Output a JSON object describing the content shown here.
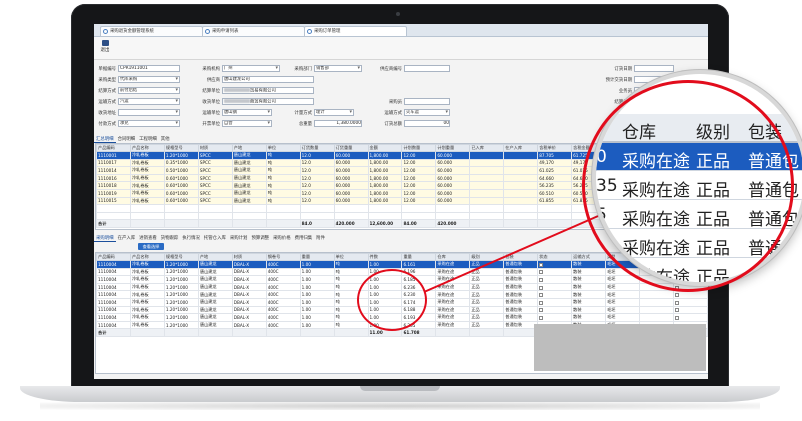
{
  "browser_tabs": [
    {
      "label": "采购退货金额管理系统"
    },
    {
      "label": "采购申请列表"
    },
    {
      "label": "采购订单管理"
    }
  ],
  "toolbar": {
    "save_label": "退出"
  },
  "form": {
    "fields": [
      {
        "label": "单据编号",
        "value": "CPR1911001"
      },
      {
        "label": "采购机构",
        "value": "广州"
      },
      {
        "label": "采购部门",
        "value": "销售部"
      },
      {
        "label": "供应商编号",
        "value": ""
      },
      {
        "label": "订货日期",
        "value": ""
      },
      {
        "label": "采购类型",
        "value": "代库采购"
      },
      {
        "label": "供应商",
        "value": "唐山建龙公司"
      },
      {
        "label": "预计交货日期",
        "value": ""
      },
      {
        "label": "结算方式",
        "value": "前付后结"
      },
      {
        "label": "结算单位",
        "value": "贸易有限公司"
      },
      {
        "label": "业务员",
        "value": ""
      },
      {
        "label": "运输方式",
        "value": "汽运"
      },
      {
        "label": "收货单位",
        "value": "商贸有限公司"
      },
      {
        "label": "采购员",
        "value": ""
      },
      {
        "label": "收货地址",
        "value": ""
      },
      {
        "label": "结算单位",
        "value": ""
      },
      {
        "label": "运输单位",
        "value": "唐山钢"
      },
      {
        "label": "计量方式",
        "value": "理计"
      },
      {
        "label": "运输方式",
        "value": "火车运"
      },
      {
        "label": "付款方式",
        "value": "承兑"
      },
      {
        "label": "开票单位",
        "value": "自营"
      },
      {
        "label": "总重量",
        "value": "1,380.0000"
      },
      {
        "label": "订货总额",
        "value": "00"
      }
    ]
  },
  "detail_tabs": [
    "汇总明细",
    "合同明细",
    "工程明细",
    "其他"
  ],
  "upper_grid": {
    "columns": [
      "产品编码",
      "产品名称",
      "规格型号",
      "材质",
      "产地",
      "单位",
      "订货数量",
      "订货重量",
      "金额",
      "计划数量",
      "计划重量",
      "已入库",
      "在产入库",
      "含税单价",
      "含税金额",
      "采购单价",
      "采购金额",
      "实际入库"
    ],
    "rows": [
      [
        "1110001",
        "冷轧卷板",
        "1.20*1000",
        "SPCC",
        "唐山建龙",
        "吨",
        "12.0",
        "60.000",
        "1,800.00",
        "12.00",
        "60.000",
        "",
        "",
        "87.705",
        "61.725",
        "30.025",
        "50.000",
        ""
      ],
      [
        "1110017",
        "冷轧卷板",
        "0.35*1000",
        "SPCC",
        "唐山建龙",
        "吨",
        "12.0",
        "60.000",
        "1,800.00",
        "12.00",
        "60.000",
        "",
        "",
        "49,170",
        "49,170",
        "",
        "",
        ""
      ],
      [
        "1110014",
        "冷轧卷板",
        "0.50*1000",
        "SPCC",
        "唐山建龙",
        "吨",
        "12.0",
        "60.000",
        "1,800.00",
        "12.00",
        "60.000",
        "",
        "",
        "61.025",
        "61.025",
        "61.025",
        "12.000",
        ""
      ],
      [
        "1110016",
        "冷轧卷板",
        "0.60*1000",
        "SPCC",
        "唐山建龙",
        "吨",
        "12.0",
        "60.000",
        "1,800.00",
        "12.00",
        "60.000",
        "",
        "",
        "64.660",
        "64.660",
        "64.660",
        "12.000",
        ""
      ],
      [
        "1110018",
        "冷轧卷板",
        "0.60*1000",
        "SPCC",
        "唐山建龙",
        "吨",
        "12.0",
        "60.000",
        "1,800.00",
        "12.00",
        "60.000",
        "",
        "",
        "56.235",
        "56.235",
        "56.235",
        "",
        ""
      ],
      [
        "1110019",
        "冷轧卷板",
        "0.60*1000",
        "SPCC",
        "唐山建龙",
        "吨",
        "12.0",
        "60.000",
        "1,800.00",
        "12.00",
        "60.000",
        "",
        "",
        "60.510",
        "60.510",
        "",
        "",
        ""
      ],
      [
        "1110015",
        "冷轧卷板",
        "0.60*1000",
        "SPCC",
        "唐山建龙",
        "吨",
        "12.0",
        "60.000",
        "1,800.00",
        "12.00",
        "60.000",
        "",
        "",
        "61.855",
        "61.855",
        "18.310",
        "18.310",
        ""
      ]
    ],
    "total_label": "合计",
    "totals": [
      "",
      "",
      "",
      "",
      "",
      "",
      "84.0",
      "420.000",
      "12,600.00",
      "84.00",
      "420.000"
    ]
  },
  "lower_tabs": [
    "采购明细",
    "在产入库",
    "进销查看",
    "货物跟踪",
    "执行情况",
    "托管仓入库",
    "采购计划",
    "预算调整",
    "采购价格",
    "费用归集",
    "附件"
  ],
  "lower_action": "查看选择",
  "lower_grid": {
    "columns": [
      "产品编码",
      "产品名称",
      "规格型号",
      "产地",
      "材质",
      "钢卷号",
      "重量",
      "单位",
      "件数",
      "重量",
      "仓库",
      "级别",
      "包装",
      "状态",
      "运输方式",
      "类型",
      "执行情况",
      "团体"
    ],
    "rows": [
      [
        "1110004",
        "冷轧卷板",
        "1.20*1000",
        "唐山建龙",
        "DBAL-X",
        "400C",
        "1.00",
        "吨",
        "1.00",
        "6.161",
        "采购在途",
        "正品",
        "普通包装",
        "",
        "散装",
        "毛坯",
        "",
        ""
      ],
      [
        "1110004",
        "冷轧卷板",
        "1.20*1000",
        "唐山建龙",
        "DBAL-X",
        "400C",
        "1.00",
        "吨",
        "1.00",
        "6.196",
        "采购在途",
        "正品",
        "普通包装",
        "",
        "散装",
        "毛坯",
        "",
        ""
      ],
      [
        "1110004",
        "冷轧卷板",
        "1.20*1000",
        "唐山建龙",
        "DBAL-X",
        "400C",
        "1.00",
        "吨",
        "1.00",
        "6.185",
        "采购在途",
        "正品",
        "普通包装",
        "",
        "散装",
        "毛坯",
        "",
        ""
      ],
      [
        "1110004",
        "冷轧卷板",
        "1.20*1000",
        "唐山建龙",
        "DBAL-X",
        "400C",
        "1.00",
        "吨",
        "1.00",
        "6.236",
        "采购在途",
        "正品",
        "普通包装",
        "",
        "散装",
        "毛坯",
        "",
        ""
      ],
      [
        "1110004",
        "冷轧卷板",
        "1.20*1000",
        "唐山建龙",
        "DBAL-X",
        "400C",
        "1.00",
        "吨",
        "1.00",
        "6.230",
        "采购在途",
        "正品",
        "普通包装",
        "",
        "散装",
        "毛坯",
        "",
        ""
      ],
      [
        "1110004",
        "冷轧卷板",
        "1.20*1000",
        "唐山建龙",
        "DBAL-X",
        "400C",
        "1.00",
        "吨",
        "1.00",
        "6.174",
        "采购在途",
        "正品",
        "普通包装",
        "",
        "散装",
        "毛坯",
        "",
        ""
      ],
      [
        "1110004",
        "冷轧卷板",
        "1.20*1000",
        "唐山建龙",
        "DBAL-X",
        "400C",
        "1.00",
        "吨",
        "1.00",
        "6.188",
        "采购在途",
        "正品",
        "普通包装",
        "",
        "散装",
        "毛坯",
        "",
        ""
      ],
      [
        "1110004",
        "冷轧卷板",
        "1.20*1000",
        "唐山建龙",
        "DBAL-X",
        "400C",
        "1.00",
        "吨",
        "1.00",
        "6.193",
        "采购在途",
        "正品",
        "普通包装",
        "",
        "散装",
        "毛坯",
        "",
        ""
      ],
      [
        "1110004",
        "冷轧卷板",
        "1.20*1000",
        "唐山建龙",
        "DBAL-X",
        "400C",
        "1.00",
        "吨",
        "1.00",
        "6.205",
        "采购在途",
        "正品",
        "普通包装",
        "",
        "散装",
        "毛坯",
        "",
        ""
      ]
    ],
    "total_label": "合计",
    "totals": [
      "",
      "",
      "",
      "",
      "",
      "",
      "",
      "",
      "11.00",
      "61.708"
    ]
  },
  "magnifier": {
    "header": [
      "仓库",
      "级别",
      "包装"
    ],
    "rows": [
      {
        "lead": "0",
        "warehouse": "采购在途",
        "grade": "正品",
        "pack": "普通包"
      },
      {
        "lead": "35",
        "warehouse": "采购在途",
        "grade": "正品",
        "pack": "普通包"
      },
      {
        "lead": "5",
        "warehouse": "采购在途",
        "grade": "正品",
        "pack": "普通包"
      },
      {
        "lead": "5",
        "warehouse": "采购在途",
        "grade": "正品",
        "pack": "普通包"
      },
      {
        "lead": "5",
        "warehouse": "采购在途",
        "grade": "正品",
        "pack": "普通包"
      }
    ]
  },
  "colors": {
    "accent": "#1c5cbf",
    "highlight": "#e20c1c",
    "bezel": "#151618"
  }
}
